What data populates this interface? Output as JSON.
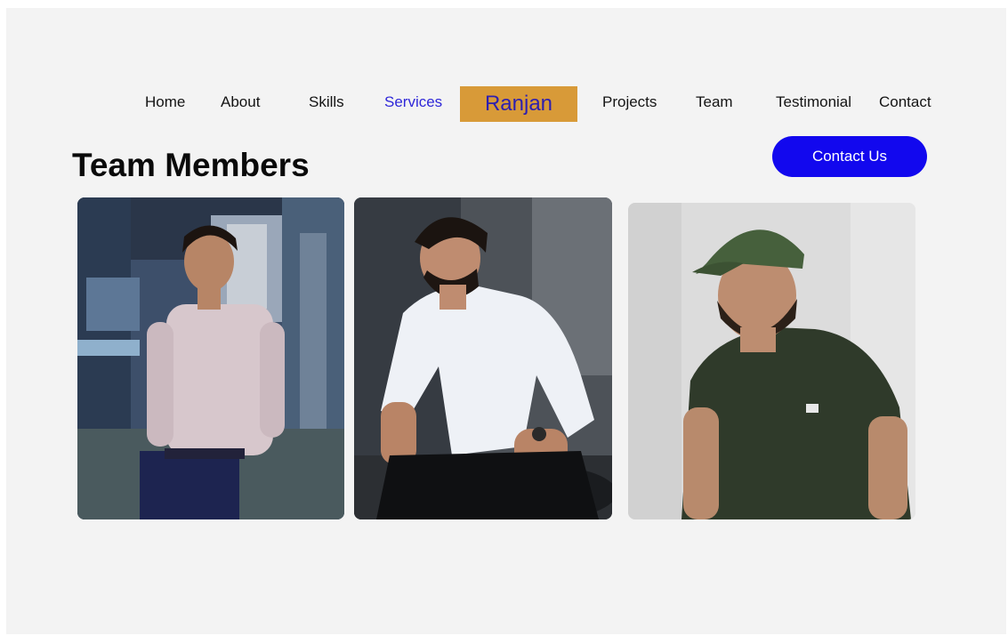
{
  "nav": {
    "items": [
      {
        "label": "Home"
      },
      {
        "label": "About"
      },
      {
        "label": "Skills"
      },
      {
        "label": "Services"
      },
      {
        "label": "Projects"
      },
      {
        "label": "Team"
      },
      {
        "label": "Testimonial"
      },
      {
        "label": "Contact"
      }
    ],
    "active": "Services",
    "brand": "Ranjan"
  },
  "section": {
    "title": "Team Members",
    "contact_button": "Contact Us"
  },
  "team": {
    "members": [
      {
        "photo": "man-in-pink-shirt-hallway"
      },
      {
        "photo": "man-in-white-shirt-seated"
      },
      {
        "photo": "man-in-green-cap-and-tee"
      }
    ]
  },
  "colors": {
    "page_background": "#f3f3f3",
    "brand_background": "#d89a38",
    "brand_text": "#2d1fb0",
    "active_nav": "#2f27d8",
    "button_background": "#1208ee",
    "button_text": "#ffffff"
  }
}
